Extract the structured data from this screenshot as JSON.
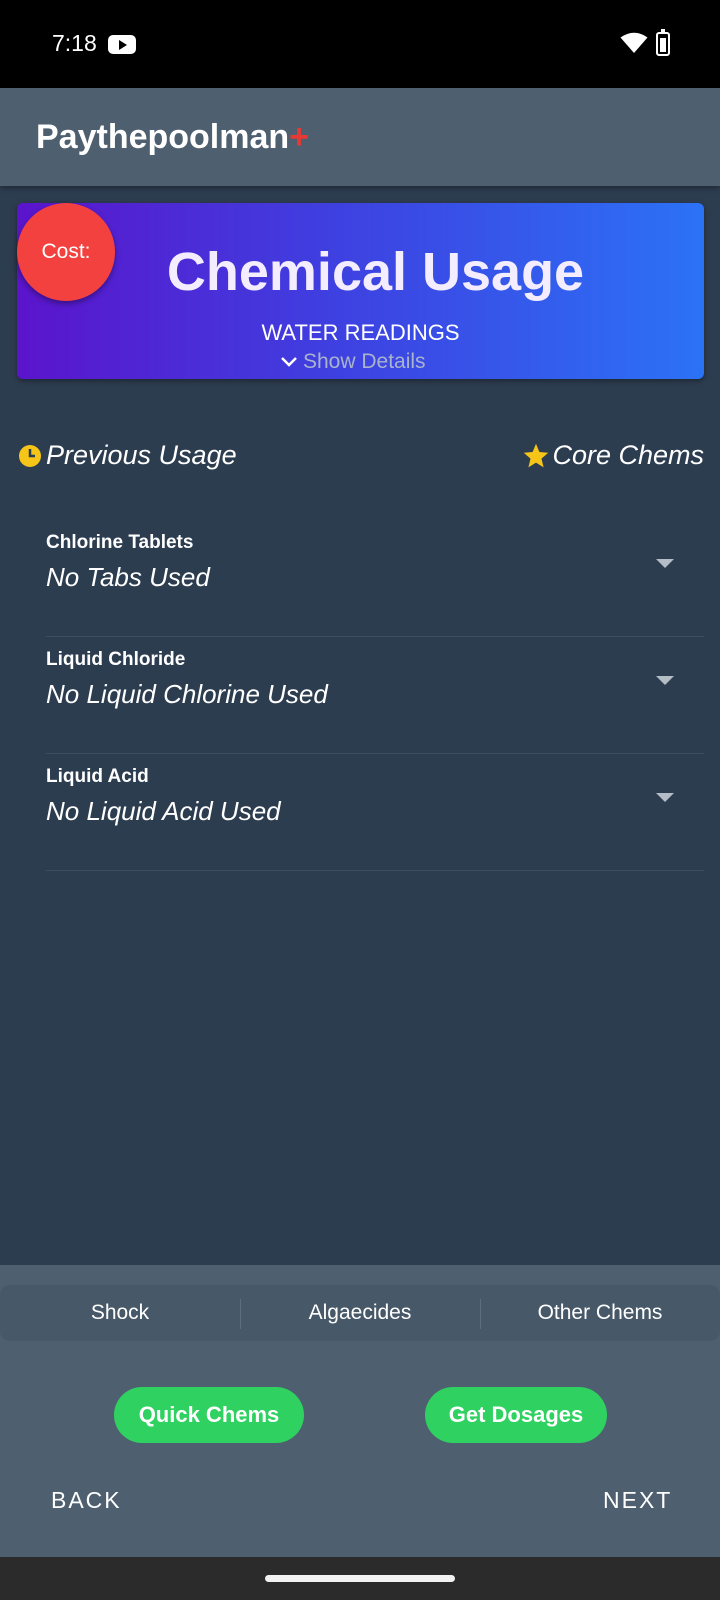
{
  "status_bar": {
    "time": "7:18",
    "icons": [
      "youtube-icon",
      "wifi-icon",
      "battery-icon"
    ]
  },
  "app_bar": {
    "title": "Paythepoolman",
    "title_suffix": "+"
  },
  "banner": {
    "title": "Chemical Usage",
    "subtitle": "WATER READINGS",
    "show_details": "Show Details",
    "cost_label": "Cost:"
  },
  "usage_links": {
    "previous": "Previous Usage",
    "core": "Core Chems"
  },
  "chemicals": [
    {
      "label": "Chlorine Tablets",
      "value": "No Tabs Used"
    },
    {
      "label": "Liquid Chloride",
      "value": "No Liquid Chlorine Used"
    },
    {
      "label": "Liquid Acid",
      "value": "No Liquid Acid Used"
    }
  ],
  "tabs": [
    {
      "label": "Shock"
    },
    {
      "label": "Algaecides"
    },
    {
      "label": "Other Chems"
    }
  ],
  "actions": {
    "quick_chems": "Quick Chems",
    "get_dosages": "Get Dosages"
  },
  "navigation": {
    "back": "BACK",
    "next": "NEXT"
  },
  "colors": {
    "accent_green": "#2fd161",
    "cost_red": "#f2413e",
    "star_yellow": "#f5c518",
    "banner_gradient": [
      "#5b14cc",
      "#2b72f6"
    ],
    "background": "#2d3d50"
  }
}
